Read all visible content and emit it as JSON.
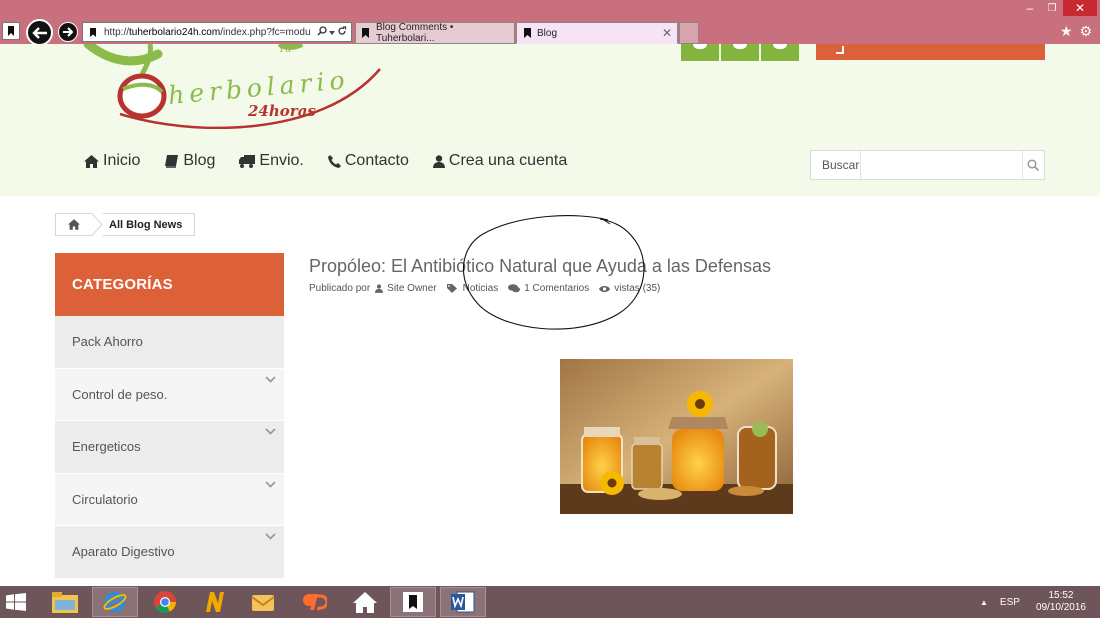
{
  "browser": {
    "url_prefix": "http://",
    "url_host": "tuherbolario24h.com",
    "url_rest": "/index.php?fc=modu",
    "tabs": [
      {
        "label": "Blog Comments • Tuherbolari..."
      },
      {
        "label": "Blog"
      }
    ],
    "win_min": "–",
    "win_max": "❐",
    "win_close": "✕"
  },
  "header": {
    "logo_text": "herbolario",
    "logo_sub": "24horas",
    "logo_tu": "Tu"
  },
  "nav": {
    "items": [
      {
        "label": "Inicio",
        "icon": "home-icon"
      },
      {
        "label": "Blog",
        "icon": "book-icon"
      },
      {
        "label": "Envio.",
        "icon": "truck-icon"
      },
      {
        "label": "Contacto",
        "icon": "phone-icon"
      },
      {
        "label": "Crea una cuenta",
        "icon": "user-icon"
      }
    ],
    "search_label": "Buscar",
    "search_value": ""
  },
  "breadcrumb": {
    "current": "All Blog News"
  },
  "sidebar": {
    "header": "CATEGORÍAS",
    "items": [
      {
        "label": "Pack Ahorro",
        "expandable": false
      },
      {
        "label": "Control de peso.",
        "expandable": true
      },
      {
        "label": "Energeticos",
        "expandable": true
      },
      {
        "label": "Circulatorio",
        "expandable": true
      },
      {
        "label": "Aparato Digestivo",
        "expandable": true
      }
    ]
  },
  "post": {
    "title": "Propóleo: El Antibiótico Natural que Ayuda a las Defensas",
    "published_by_label": "Publicado por",
    "author": "Site Owner",
    "category": "Noticias",
    "comments": "1 Comentarios",
    "views": "vistas (35)"
  },
  "taskbar": {
    "lang": "ESP",
    "time": "15:52",
    "date": "09/10/2016"
  },
  "colors": {
    "accent_orange": "#dd6138",
    "brand_green": "#81b53d",
    "header_bg": "#f4faea",
    "chrome_bg": "#c9707f",
    "taskbar_bg": "#6e555a"
  }
}
